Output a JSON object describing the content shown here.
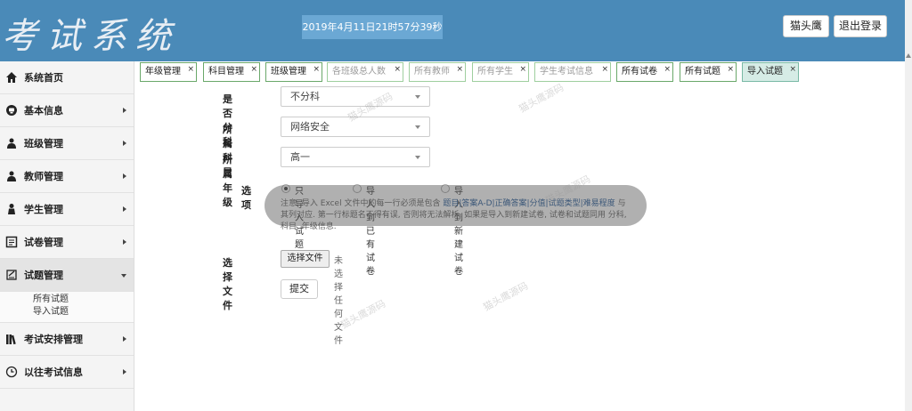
{
  "header": {
    "logo": "考试系统",
    "clock": "2019年4月11日21时57分39秒",
    "user_button": "猫头鹰",
    "logout_button": "退出登录"
  },
  "sidebar": {
    "items": [
      {
        "label": "系统首页",
        "icon": "home-icon"
      },
      {
        "label": "基本信息",
        "icon": "info-icon"
      },
      {
        "label": "班级管理",
        "icon": "class-icon"
      },
      {
        "label": "教师管理",
        "icon": "teacher-icon"
      },
      {
        "label": "学生管理",
        "icon": "student-icon"
      },
      {
        "label": "试卷管理",
        "icon": "paper-icon"
      },
      {
        "label": "试题管理",
        "icon": "question-icon"
      },
      {
        "label": "考试安排管理",
        "icon": "books-icon"
      },
      {
        "label": "以往考试信息",
        "icon": "clock-icon"
      }
    ],
    "sub_items": [
      "所有试题",
      "导入试题"
    ]
  },
  "tabs": [
    {
      "label": "年级管理"
    },
    {
      "label": "科目管理"
    },
    {
      "label": "班级管理"
    },
    {
      "label": "各班级总人数"
    },
    {
      "label": "所有教师"
    },
    {
      "label": "所有学生"
    },
    {
      "label": "学生考试信息"
    },
    {
      "label": "所有试卷"
    },
    {
      "label": "所有试题"
    },
    {
      "label": "导入试题"
    }
  ],
  "form": {
    "split_label": "是否分科",
    "split_value": "不分科",
    "subject_label": "所属科目",
    "subject_value": "网络安全",
    "grade_label": "所属年级",
    "grade_value": "高一",
    "options_label": "选项",
    "options": [
      "只导入试题",
      "导入到已有试卷",
      "导入到新建试卷"
    ],
    "note_part1": "注意: 导入 Excel 文件中的每一行必须是包含 ",
    "note_highlight": "题目|答案A-D|正确答案|分值|试题类型|难易程度",
    "note_part2": " 与其列对应. 第一行标题名不得有误, 否则将无法解析. 如果是导入到新建试卷, 试卷和试题同用 分科, 科目, 年级信息.",
    "file_label": "选择文件",
    "file_button": "选择文件",
    "file_none": "未选择任何文件",
    "submit_button": "提交"
  },
  "watermark": "猫头鹰源码"
}
